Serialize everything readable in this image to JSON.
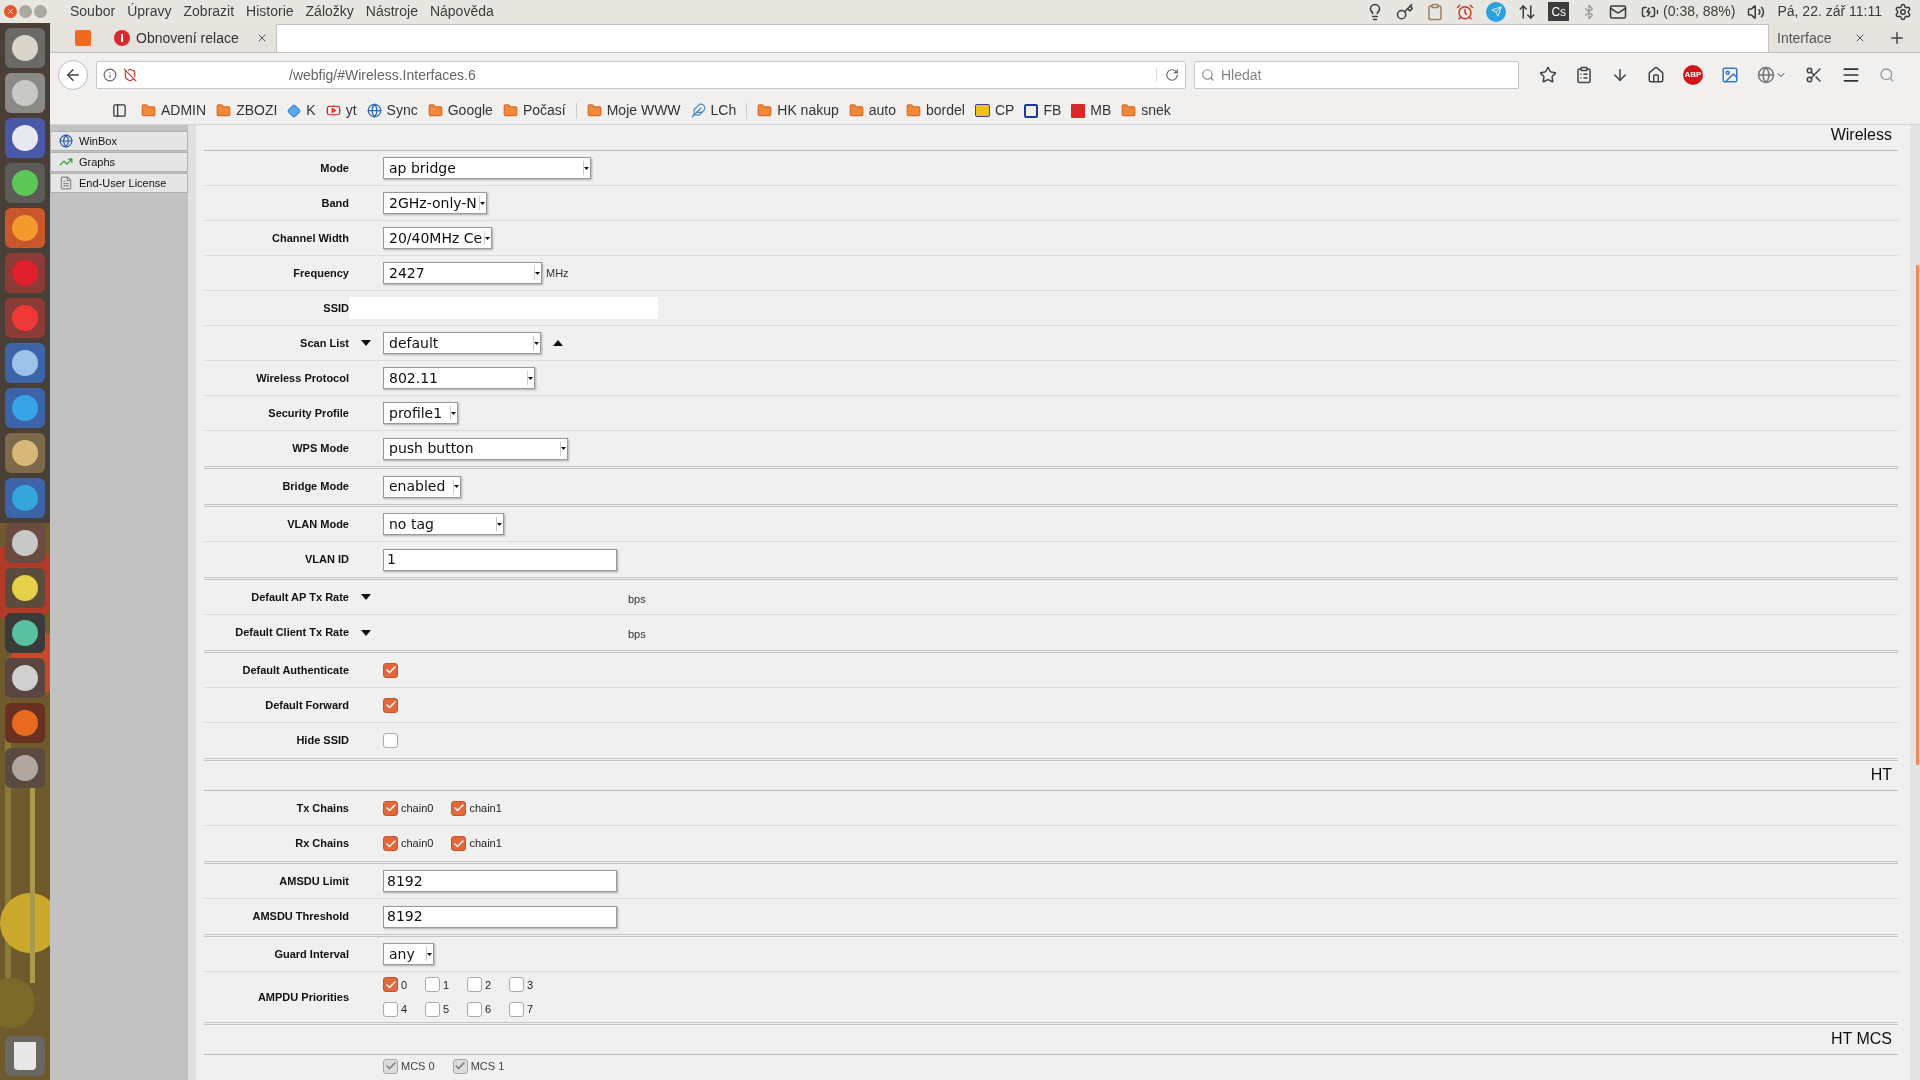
{
  "menubar": {
    "items": [
      "Soubor",
      "Úpravy",
      "Zobrazit",
      "Historie",
      "Záložky",
      "Nástroje",
      "Nápověda"
    ],
    "tray_badge": "Cs",
    "battery": "(0:38, 88%)",
    "clock": "Pá, 22. zář 11:11"
  },
  "tabs": [
    {
      "kind": "pinned",
      "selected": false
    },
    {
      "kind": "warning",
      "title": "Obnovení relace",
      "selected": false
    },
    {
      "kind": "blank",
      "selected": true
    },
    {
      "kind": "plain",
      "title": "Interface",
      "selected": false
    }
  ],
  "url": "/webfig/#Wireless.Interfaces.6",
  "search": {
    "placeholder": "Hledat"
  },
  "abp_badge": "ABP",
  "bookmarks": [
    {
      "kind": "folder",
      "label": "ADMIN"
    },
    {
      "kind": "folder",
      "label": "ZBOZI"
    },
    {
      "kind": "diamond",
      "label": "K"
    },
    {
      "kind": "play",
      "label": "yt"
    },
    {
      "kind": "globe",
      "label": "Sync"
    },
    {
      "kind": "folder",
      "label": "Google"
    },
    {
      "kind": "folder",
      "label": "Počasí"
    },
    {
      "kind": "separator"
    },
    {
      "kind": "folder",
      "label": "Moje WWW"
    },
    {
      "kind": "bird",
      "label": "LCh"
    },
    {
      "kind": "separator"
    },
    {
      "kind": "folder",
      "label": "HK nakup"
    },
    {
      "kind": "folder",
      "label": "auto"
    },
    {
      "kind": "folder",
      "label": "bordel"
    },
    {
      "kind": "horn",
      "label": "CP"
    },
    {
      "kind": "emblem",
      "label": "FB"
    },
    {
      "kind": "m",
      "label": "MB"
    },
    {
      "kind": "folder",
      "label": "snek"
    }
  ],
  "webfig_menu": [
    {
      "label": "WinBox",
      "kind": "globe"
    },
    {
      "label": "Graphs",
      "kind": "chart"
    },
    {
      "label": "End-User License",
      "kind": "doc"
    }
  ],
  "sections": [
    {
      "title": "Wireless",
      "groups": [
        [
          {
            "label": "Mode",
            "kind": "select",
            "value": "ap bridge"
          },
          {
            "label": "Band",
            "kind": "select",
            "value": "2GHz-only-N"
          },
          {
            "label": "Channel Width",
            "kind": "select",
            "value": "20/40MHz Ce"
          },
          {
            "label": "Frequency",
            "kind": "select",
            "value": "2427",
            "unit": "MHz"
          },
          {
            "label": "SSID",
            "kind": "text"
          },
          {
            "label": "Scan List",
            "kind": "select",
            "value": "default",
            "expander": true,
            "collapser": true
          },
          {
            "label": "Wireless Protocol",
            "kind": "select",
            "value": "802.11"
          },
          {
            "label": "Security Profile",
            "kind": "select",
            "value": "profile1"
          },
          {
            "label": "WPS Mode",
            "kind": "select",
            "value": "push button"
          }
        ],
        [
          {
            "label": "Bridge Mode",
            "kind": "select",
            "value": "enabled"
          }
        ],
        [
          {
            "label": "VLAN Mode",
            "kind": "select",
            "value": "no tag"
          },
          {
            "label": "VLAN ID",
            "kind": "text",
            "value": "1"
          }
        ],
        [
          {
            "label": "Default AP Tx Rate",
            "kind": "rate",
            "expander": true,
            "unit": "bps"
          },
          {
            "label": "Default Client Tx Rate",
            "kind": "rate",
            "expander": true,
            "unit": "bps"
          }
        ],
        [
          {
            "label": "Default Authenticate",
            "kind": "checkbox",
            "checked": true
          },
          {
            "label": "Default Forward",
            "kind": "checkbox",
            "checked": true
          },
          {
            "label": "Hide SSID",
            "kind": "checkbox",
            "checked": false
          }
        ]
      ]
    },
    {
      "title": "HT",
      "groups": [
        [
          {
            "label": "Tx Chains",
            "kind": "options",
            "options": [
              {
                "label": "chain0",
                "checked": true,
                "disabled": false
              },
              {
                "label": "chain1",
                "checked": true,
                "disabled": false
              }
            ]
          },
          {
            "label": "Rx Chains",
            "kind": "options",
            "options": [
              {
                "label": "chain0",
                "checked": true,
                "disabled": false
              },
              {
                "label": "chain1",
                "checked": true,
                "disabled": false
              }
            ]
          }
        ],
        [
          {
            "label": "AMSDU Limit",
            "kind": "text",
            "value": "8192"
          },
          {
            "label": "AMSDU Threshold",
            "kind": "text",
            "value": "8192"
          }
        ],
        [
          {
            "label": "Guard Interval",
            "kind": "select",
            "value": "any"
          },
          {
            "label": "AMPDU Priorities",
            "kind": "grid",
            "options": [
              {
                "label": "0",
                "checked": true
              },
              {
                "label": "1",
                "checked": false
              },
              {
                "label": "2",
                "checked": false
              },
              {
                "label": "3",
                "checked": false
              },
              {
                "label": "4",
                "checked": false
              },
              {
                "label": "5",
                "checked": false
              },
              {
                "label": "6",
                "checked": false
              },
              {
                "label": "7",
                "checked": false
              }
            ]
          }
        ]
      ]
    },
    {
      "title": "HT MCS",
      "groups": [
        [
          {
            "kind": "options",
            "options": [
              {
                "label": "MCS 0",
                "checked": true,
                "disabled": true
              },
              {
                "label": "MCS 1",
                "checked": true,
                "disabled": true
              }
            ]
          }
        ]
      ]
    }
  ]
}
